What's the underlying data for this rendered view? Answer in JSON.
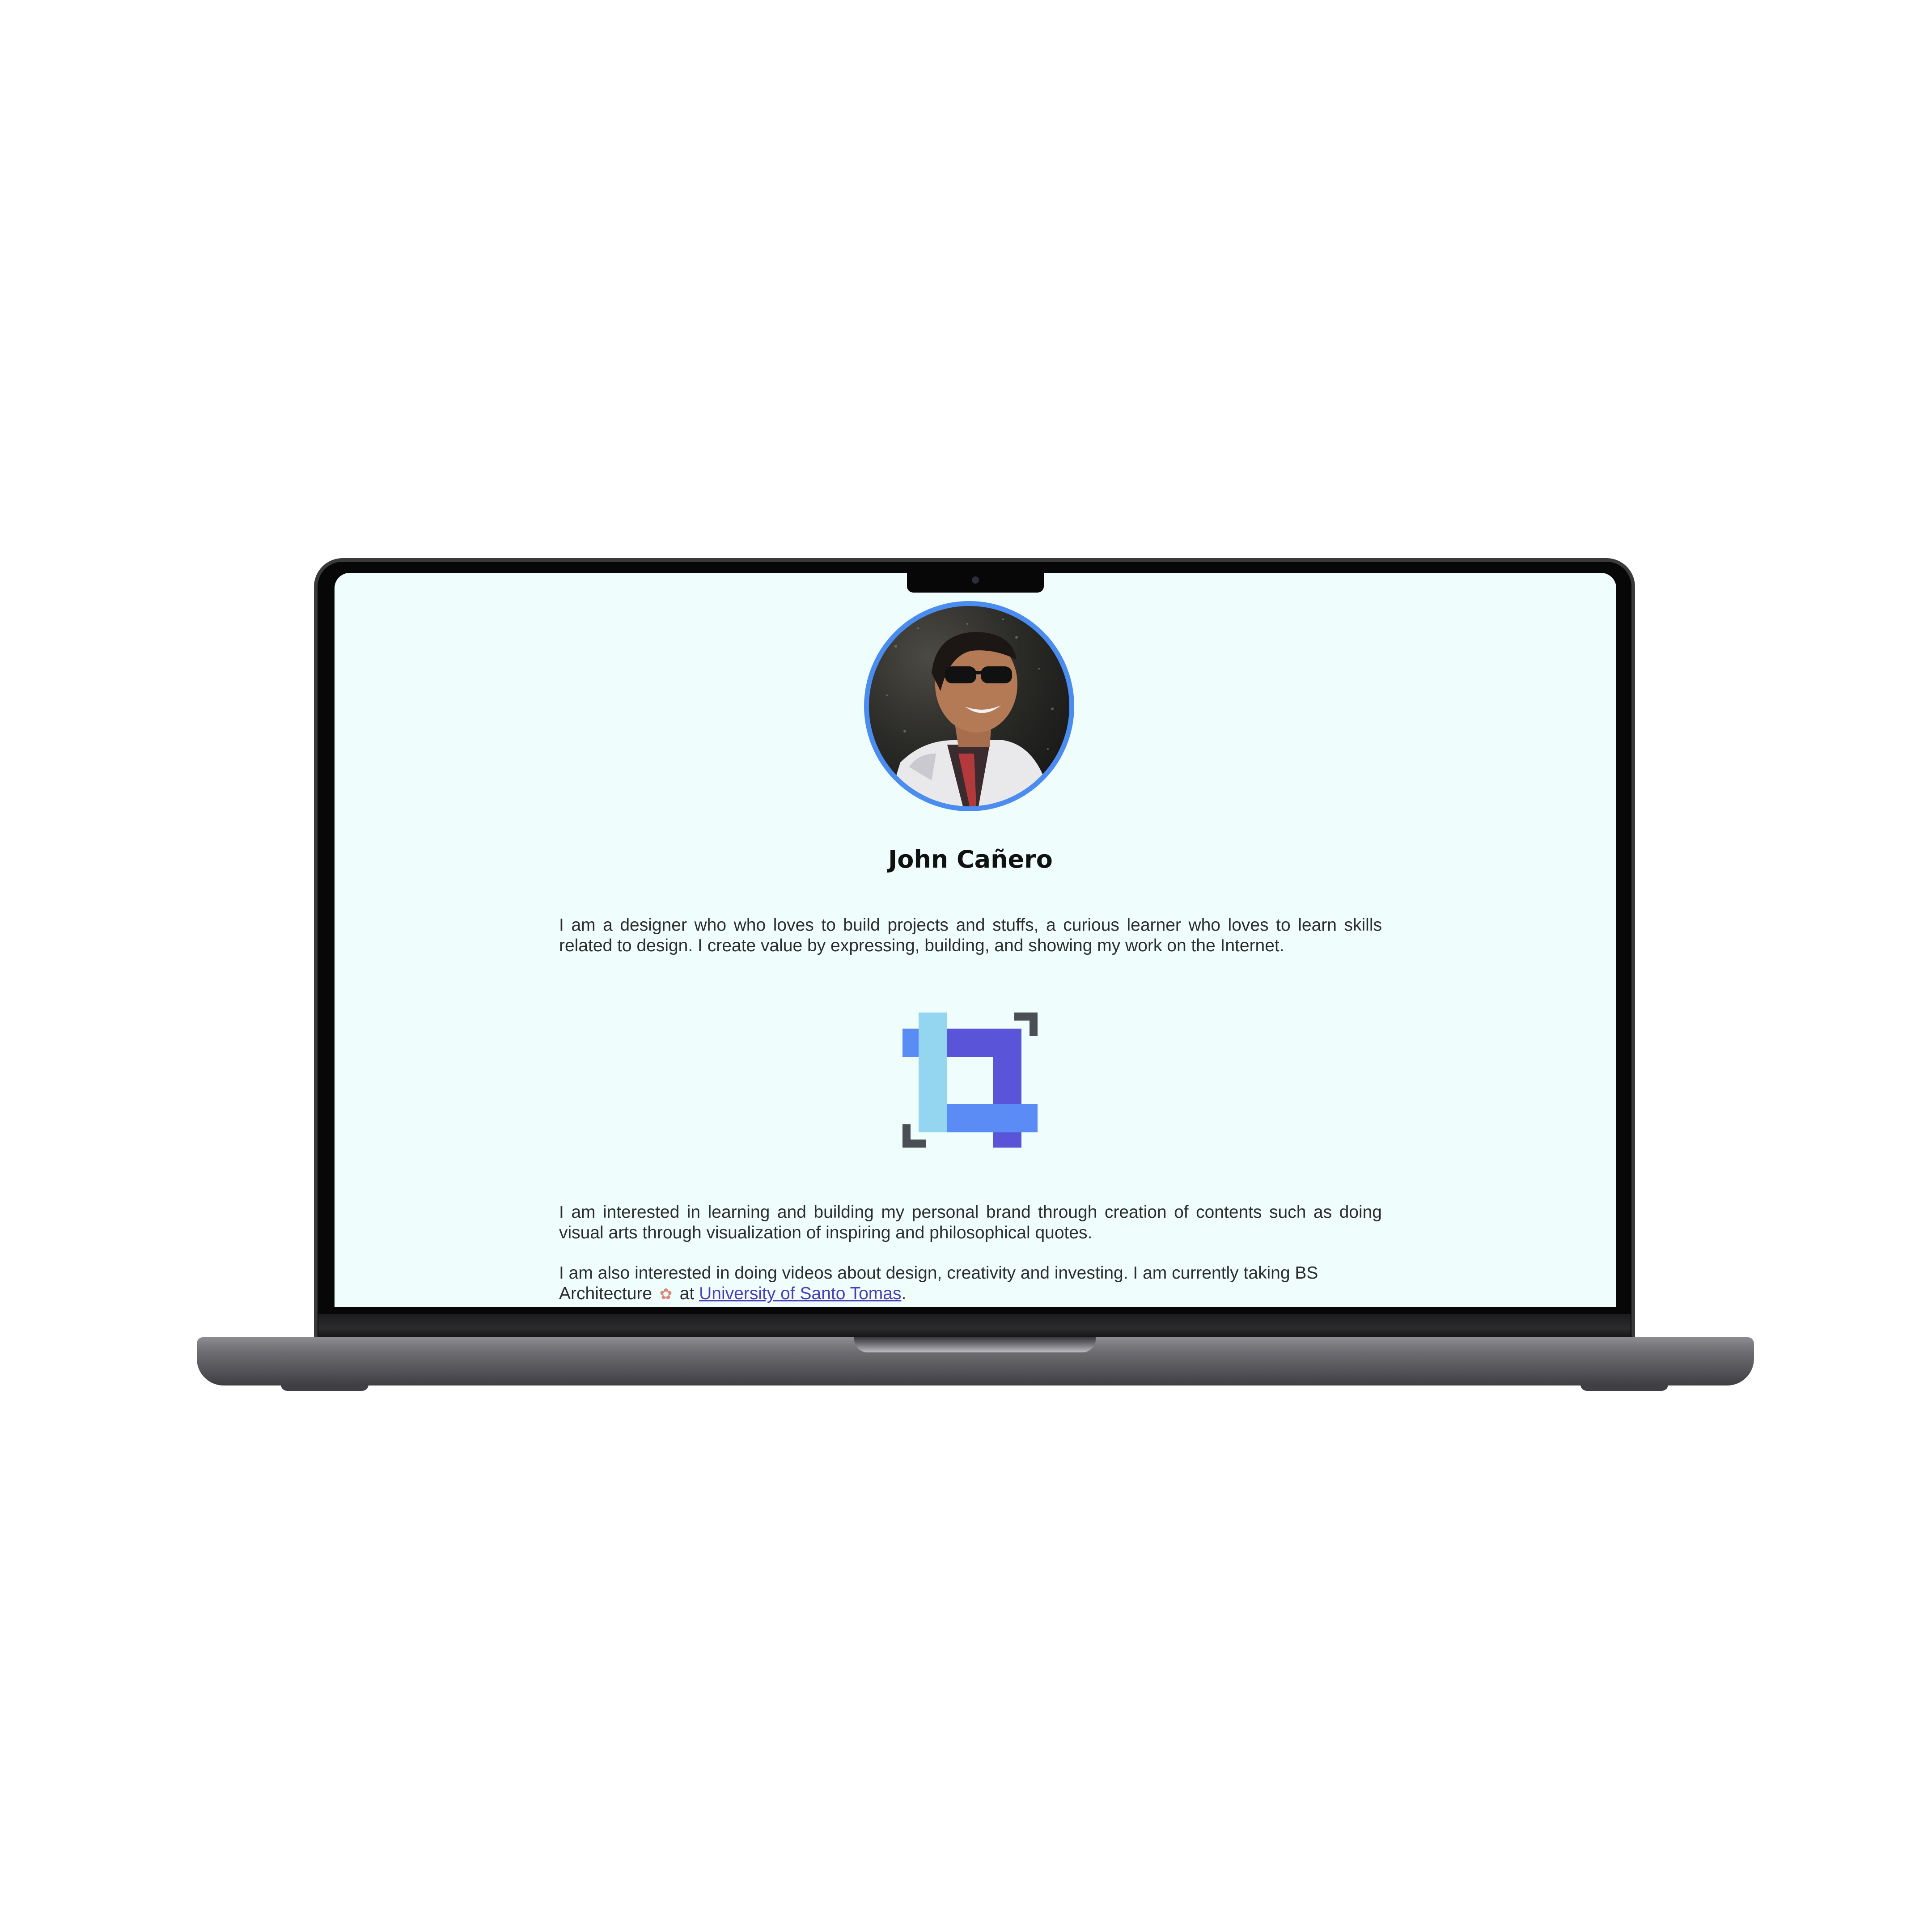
{
  "profile": {
    "name": "John Cañero",
    "avatar_alt": "profile photo"
  },
  "intro": "I am a designer who who loves to build projects and stuffs, a curious learner who loves to learn skills related to design. I create value by expressing, building, and showing my work on the Internet.",
  "interests": "I am interested in learning and building my personal brand through creation of contents such as doing visual arts through visualization of inspiring and philosophical quotes.",
  "study": {
    "text_before": "I am also interested in doing videos about design, creativity and investing. I am currently taking BS Architecture",
    "text_at": " at ",
    "link_label": "University of Santo Tomas",
    "text_after": "."
  },
  "icons": {
    "palette": "palette-icon",
    "logo": "crop-logo-icon"
  },
  "colors": {
    "screen_bg": "#effefd",
    "avatar_ring": "#4a8cf0",
    "link": "#4b3fb8",
    "logo_light_blue": "#94d5f0",
    "logo_blue": "#5b8cf5",
    "logo_purple": "#5a55d8",
    "logo_dark": "#4a4f55"
  }
}
